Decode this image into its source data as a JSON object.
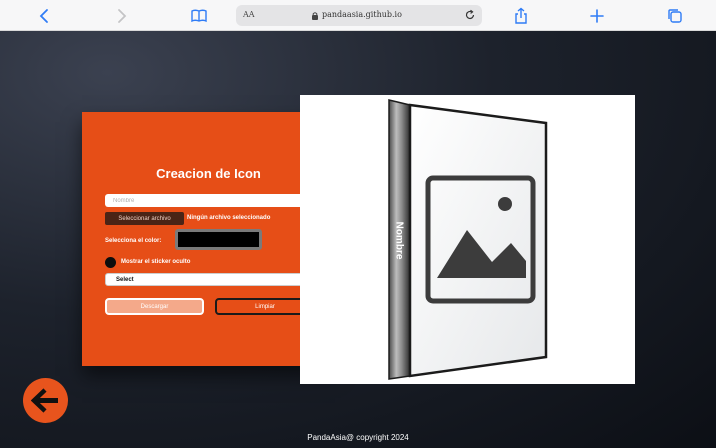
{
  "browser": {
    "text_size_label": "AA",
    "url": "pandaasia.github.io"
  },
  "form": {
    "title": "Creacion de Icon",
    "name_placeholder": "Nombre",
    "file_button_label": "Seleccionar archivo",
    "file_status": "Ningún archivo seleccionado",
    "color_label": "Selecciona el color:",
    "color_value": "#000000",
    "hidden_sticker_label": "Mostrar el sticker oculto",
    "select_value": "Select",
    "download_label": "Descargar",
    "clear_label": "Limpiar"
  },
  "preview": {
    "spine_text": "Nombre",
    "image_icon": "image-placeholder-icon"
  },
  "footer": {
    "text": "PandaAsia@ copyright 2024"
  },
  "icons": {
    "back": "arrow-left-icon"
  },
  "colors": {
    "card": "#e64e17",
    "accent_button": "#e8541d",
    "swatch": "#000000"
  }
}
